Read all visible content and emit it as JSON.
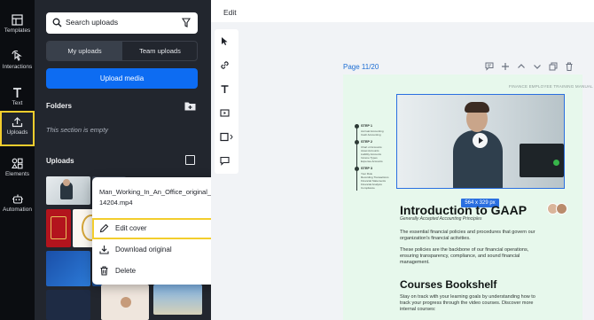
{
  "rail": {
    "items": [
      {
        "label": "Templates",
        "icon": "templates-icon"
      },
      {
        "label": "Interactions",
        "icon": "interactions-icon"
      },
      {
        "label": "Text",
        "icon": "text-icon"
      },
      {
        "label": "Uploads",
        "icon": "uploads-icon",
        "active": true
      },
      {
        "label": "Elements",
        "icon": "elements-icon"
      },
      {
        "label": "Automation",
        "icon": "automation-icon"
      }
    ]
  },
  "panel": {
    "search_placeholder": "Search uploads",
    "tabs": [
      "My uploads",
      "Team uploads"
    ],
    "upload_button": "Upload media",
    "folders_title": "Folders",
    "folders_empty": "This section is empty",
    "uploads_title": "Uploads"
  },
  "context_menu": {
    "filename": "Man_Working_In_An_Office_original_1614204.mp4",
    "items": [
      {
        "label": "Edit cover",
        "icon": "pencil-icon",
        "highlighted": true
      },
      {
        "label": "Download original",
        "icon": "download-icon"
      },
      {
        "label": "Delete",
        "icon": "trash-icon"
      }
    ]
  },
  "editor": {
    "top_label": "Edit",
    "page_label": "Page 11/20"
  },
  "document": {
    "header_small": "FINANCE EMPLOYEE TRAINING MANUAL",
    "steps": [
      {
        "title": "STEP 1",
        "lines": [
          "Accrual Accounting",
          "Cash Accounting"
        ]
      },
      {
        "title": "STEP 2",
        "lines": [
          "Chart of Accounts",
          "Asset Accounts",
          "Liability Accounts",
          "Income Types",
          "Expense Accounts"
        ]
      },
      {
        "title": "STEP 3",
        "lines": [
          "Your Role",
          "Recording Transactions",
          "Financial Statements",
          "Financial Analysis",
          "Compliance"
        ]
      }
    ],
    "video_size": "564 x 329 px",
    "title": "Introduction to GAAP",
    "subtitle": "Generally Accepted Accounting Principles",
    "para1": "The essential financial policies and procedures that govern our organization's financial activities.",
    "para2": "These policies are the backbone of our financial operations, ensuring transparency, compliance, and sound financial management.",
    "title2": "Courses Bookshelf",
    "para3": "Stay on track with your learning goals by understanding how to track your progress through the video courses. Discover more internal courses:"
  },
  "colors": {
    "rail_bg": "#0b0d11",
    "panel_bg": "#22262e",
    "accent_blue": "#0d6cf2",
    "highlight_yellow": "#f3cd2d",
    "doc_bg": "#e7f8ec"
  }
}
